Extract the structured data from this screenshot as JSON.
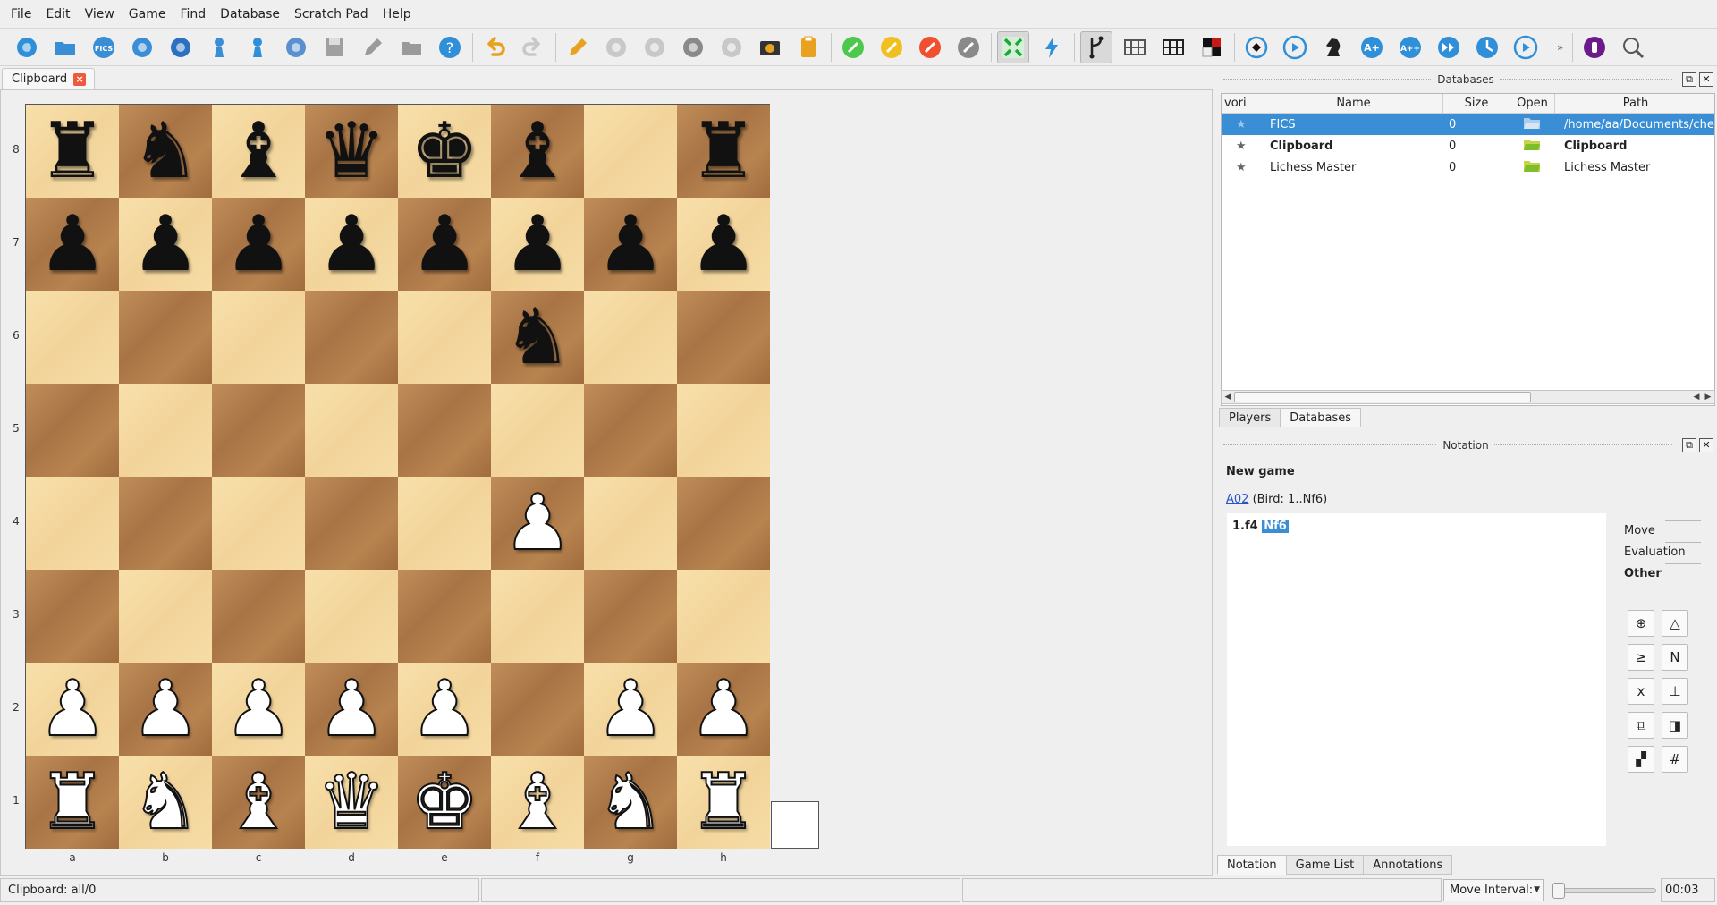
{
  "menu": [
    "File",
    "Edit",
    "View",
    "Game",
    "Find",
    "Database",
    "Scratch Pad",
    "Help"
  ],
  "toolbar": {
    "icons": [
      {
        "name": "new-database-icon",
        "color": "#2f8fd8"
      },
      {
        "name": "open-folder-icon",
        "color": "#3a8ed6"
      },
      {
        "name": "fics-icon",
        "color": "#3a8ed6",
        "text": "FICS"
      },
      {
        "name": "lichess-icon",
        "color": "#3a8ed6"
      },
      {
        "name": "chesscom-icon",
        "color": "#2c70c0"
      },
      {
        "name": "chess-engine-icon",
        "color": "#3a8ed6"
      },
      {
        "name": "pawn-icon",
        "color": "#2f8fd8"
      },
      {
        "name": "web-database-icon",
        "color": "#5a8fd0"
      },
      {
        "name": "save-icon",
        "color": "#a0a0a0"
      },
      {
        "name": "quill-icon",
        "color": "#9a9a9a"
      },
      {
        "name": "folder-icon",
        "color": "#9a9a9a"
      },
      {
        "name": "help-icon",
        "color": "#2f8fd8"
      },
      {
        "name": "undo-icon",
        "color": "#e8a21f"
      },
      {
        "name": "redo-icon",
        "color": "#c8c8c8"
      },
      {
        "name": "edit-pencil-icon",
        "color": "#e8a21f"
      },
      {
        "name": "paste-icon",
        "color": "#c8c8c8"
      },
      {
        "name": "paste-list-icon",
        "color": "#c8c8c8"
      },
      {
        "name": "board-setup-icon",
        "color": "#8a8a8a"
      },
      {
        "name": "copy-icon",
        "color": "#c8c8c8"
      },
      {
        "name": "camera-icon",
        "color": "#e8a21f"
      },
      {
        "name": "clipboard-icon",
        "color": "#e8a21f"
      },
      {
        "name": "green-marker-icon",
        "color": "#4cc84c"
      },
      {
        "name": "yellow-marker-icon",
        "color": "#f0c020"
      },
      {
        "name": "red-marker-icon",
        "color": "#f05030"
      },
      {
        "name": "clear-marker-icon",
        "color": "#8a8a8a"
      },
      {
        "name": "arrows-in-icon",
        "color": "#1aa83a"
      },
      {
        "name": "lightning-icon",
        "color": "#2f8fd8"
      },
      {
        "name": "branch-icon",
        "color": "#222222"
      },
      {
        "name": "board-grid-icon",
        "color": "#555555"
      },
      {
        "name": "board-black-grid-icon",
        "color": "#222222"
      },
      {
        "name": "red-square-icon",
        "color": "#c81818"
      },
      {
        "name": "flip-board-icon",
        "color": "#111111"
      },
      {
        "name": "autoplay-icon",
        "color": "#2f8fd8"
      },
      {
        "name": "chess-knight-icon",
        "color": "#222222"
      },
      {
        "name": "annotate-plus-icon",
        "color": "#2f8fd8",
        "text": "A+"
      },
      {
        "name": "annotate-plusplus-icon",
        "color": "#2f8fd8",
        "text": "A++"
      },
      {
        "name": "fast-forward-icon",
        "color": "#2f8fd8"
      },
      {
        "name": "training-icon",
        "color": "#2f8fd8"
      },
      {
        "name": "play-icon",
        "color": "#2f8fd8"
      },
      {
        "name": "purple-circle-icon",
        "color": "#6a1a8a"
      },
      {
        "name": "text-search-icon",
        "color": "#555555"
      }
    ]
  },
  "tabs": {
    "document": "Clipboard"
  },
  "board": {
    "files": [
      "a",
      "b",
      "c",
      "d",
      "e",
      "f",
      "g",
      "h"
    ],
    "ranks": [
      "8",
      "7",
      "6",
      "5",
      "4",
      "3",
      "2",
      "1"
    ],
    "fen_rows": [
      "rnbqkb.r",
      "pppppppp",
      ".....n..",
      "........",
      ".....P..",
      "........",
      "PPPPP.PP",
      "RNBQKBNR"
    ],
    "light_color": "#f6dca6",
    "dark_color": "#b07a47"
  },
  "databases_panel": {
    "title": "Databases",
    "columns": [
      "vori",
      "Name",
      "Size",
      "Open",
      "Path"
    ],
    "rows": [
      {
        "name": "FICS",
        "size": "0",
        "path": "/home/aa/Documents/chessda",
        "selected": true,
        "bold": false
      },
      {
        "name": "Clipboard",
        "size": "0",
        "path": "Clipboard",
        "selected": false,
        "bold": true
      },
      {
        "name": "Lichess Master",
        "size": "0",
        "path": "Lichess Master",
        "selected": false,
        "bold": false
      }
    ],
    "tabs": [
      "Players",
      "Databases"
    ]
  },
  "notation_panel": {
    "title": "Notation",
    "game_title": "New game",
    "eco_code": "A02",
    "eco_desc": " (Bird: 1..Nf6)",
    "move_number": "1.f4",
    "current_move": "Nf6",
    "side_tabs": [
      "Move",
      "Evaluation",
      "Other"
    ],
    "symbols": [
      "⊕",
      "△",
      "≥",
      "N",
      "x",
      "⊥",
      "⧉",
      "◨",
      "▞",
      "#"
    ],
    "bottom_tabs": [
      "Notation",
      "Game List",
      "Annotations"
    ]
  },
  "status": {
    "left": "Clipboard: all/0",
    "interval_label": "Move Interval:",
    "interval_fraction": 0,
    "time": "00:03"
  }
}
